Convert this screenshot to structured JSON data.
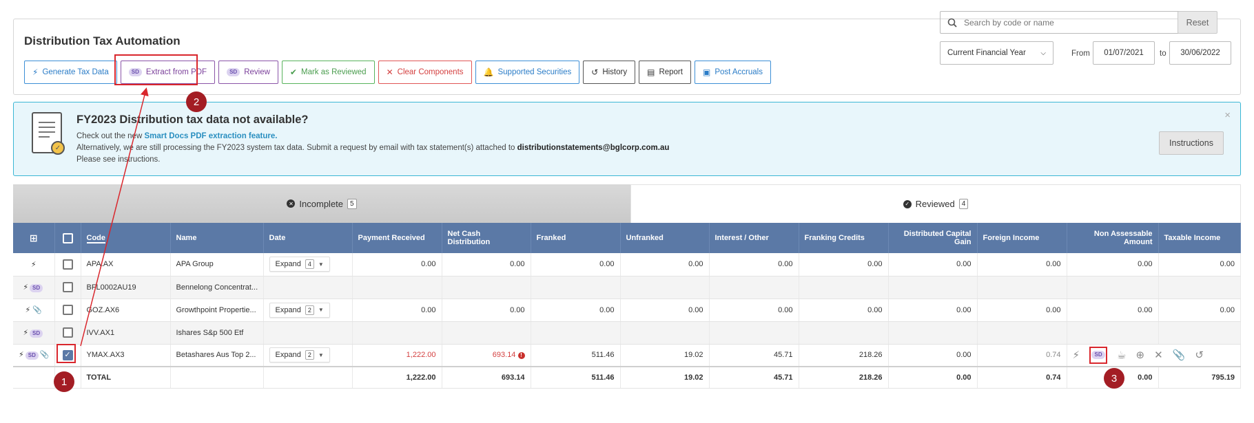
{
  "header": {
    "title": "Distribution Tax Automation",
    "toolbar": [
      {
        "label": "Generate Tax Data",
        "icon": "bolt-icon",
        "style": "blue"
      },
      {
        "label": "Extract from PDF",
        "icon": "sd-icon",
        "style": "purple"
      },
      {
        "label": "Review",
        "icon": "sd-icon",
        "style": "purple"
      },
      {
        "label": "Mark as Reviewed",
        "icon": "check-circle-icon",
        "style": "green"
      },
      {
        "label": "Clear Components",
        "icon": "close-icon",
        "style": "red"
      },
      {
        "label": "Supported Securities",
        "icon": "bell-icon",
        "style": "blue"
      },
      {
        "label": "History",
        "icon": "history-icon",
        "style": "dark"
      },
      {
        "label": "Report",
        "icon": "document-icon",
        "style": "dark"
      },
      {
        "label": "Post Accruals",
        "icon": "calendar-check-icon",
        "style": "blue"
      }
    ],
    "search_placeholder": "Search by code or name",
    "reset_label": "Reset",
    "period_value": "Current Financial Year",
    "from_label": "From",
    "from_date": "01/07/2021",
    "to_label": "to",
    "to_date": "30/06/2022"
  },
  "banner": {
    "title": "FY2023 Distribution tax data not available?",
    "line1_prefix": "Check out the new ",
    "line1_link": "Smart Docs PDF extraction feature.",
    "line2_prefix": "Alternatively, we are still processing the FY2023 system tax data. Submit a request by email with tax statement(s) attached to ",
    "line2_email": "distributionstatements@bglcorp.com.au",
    "line3": "Please see instructions.",
    "instructions_label": "Instructions",
    "close_glyph": "×"
  },
  "tabs": {
    "incomplete_label": "Incomplete",
    "incomplete_count": "5",
    "reviewed_label": "Reviewed",
    "reviewed_count": "4"
  },
  "table": {
    "columns": [
      "Code",
      "Name",
      "Date",
      "Payment Received",
      "Net Cash Distribution",
      "Franked",
      "Unfranked",
      "Interest / Other",
      "Franking Credits",
      "Distributed Capital Gain",
      "Foreign Income",
      "Non Assessable Amount",
      "Taxable Income"
    ],
    "expand_label": "Expand",
    "rows": [
      {
        "icons": "bolt",
        "code": "APA.AX",
        "name": "APA Group",
        "expand_count": "4",
        "payment": "0.00",
        "net": "0.00",
        "franked": "0.00",
        "unfranked": "0.00",
        "interest": "0.00",
        "credits": "0.00",
        "capital": "0.00",
        "foreign": "0.00",
        "non_assessable": "0.00",
        "taxable": "0.00"
      },
      {
        "icons": "bolt-sd",
        "code": "BFL0002AU19",
        "name": "Bennelong Concentrat..."
      },
      {
        "icons": "bolt-clip",
        "code": "GOZ.AX6",
        "name": "Growthpoint Propertie...",
        "expand_count": "2",
        "payment": "0.00",
        "net": "0.00",
        "franked": "0.00",
        "unfranked": "0.00",
        "interest": "0.00",
        "credits": "0.00",
        "capital": "0.00",
        "foreign": "0.00",
        "non_assessable": "0.00",
        "taxable": "0.00"
      },
      {
        "icons": "bolt-sd",
        "code": "IVV.AX1",
        "name": "Ishares S&p 500 Etf"
      },
      {
        "icons": "bolt-sd-clip",
        "code": "YMAX.AX3",
        "name": "Betashares Aus Top 2...",
        "expand_count": "2",
        "payment": "1,222.00",
        "net": "693.14",
        "franked": "511.46",
        "unfranked": "19.02",
        "interest": "45.71",
        "credits": "218.26",
        "capital": "0.00",
        "foreign": "0.74"
      }
    ],
    "total": {
      "label": "TOTAL",
      "payment": "1,222.00",
      "net": "693.14",
      "franked": "511.46",
      "unfranked": "19.02",
      "interest": "45.71",
      "credits": "218.26",
      "capital": "0.00",
      "foreign": "0.74",
      "non_assessable": "0.00",
      "taxable": "795.19"
    }
  },
  "annotations": {
    "marker1": "1",
    "marker2": "2",
    "marker3": "3"
  },
  "colors": {
    "header_blue": "#5b79a6",
    "highlight_red": "#d9262c",
    "marker_red": "#a31d24",
    "banner_bg": "#e8f6fb"
  }
}
